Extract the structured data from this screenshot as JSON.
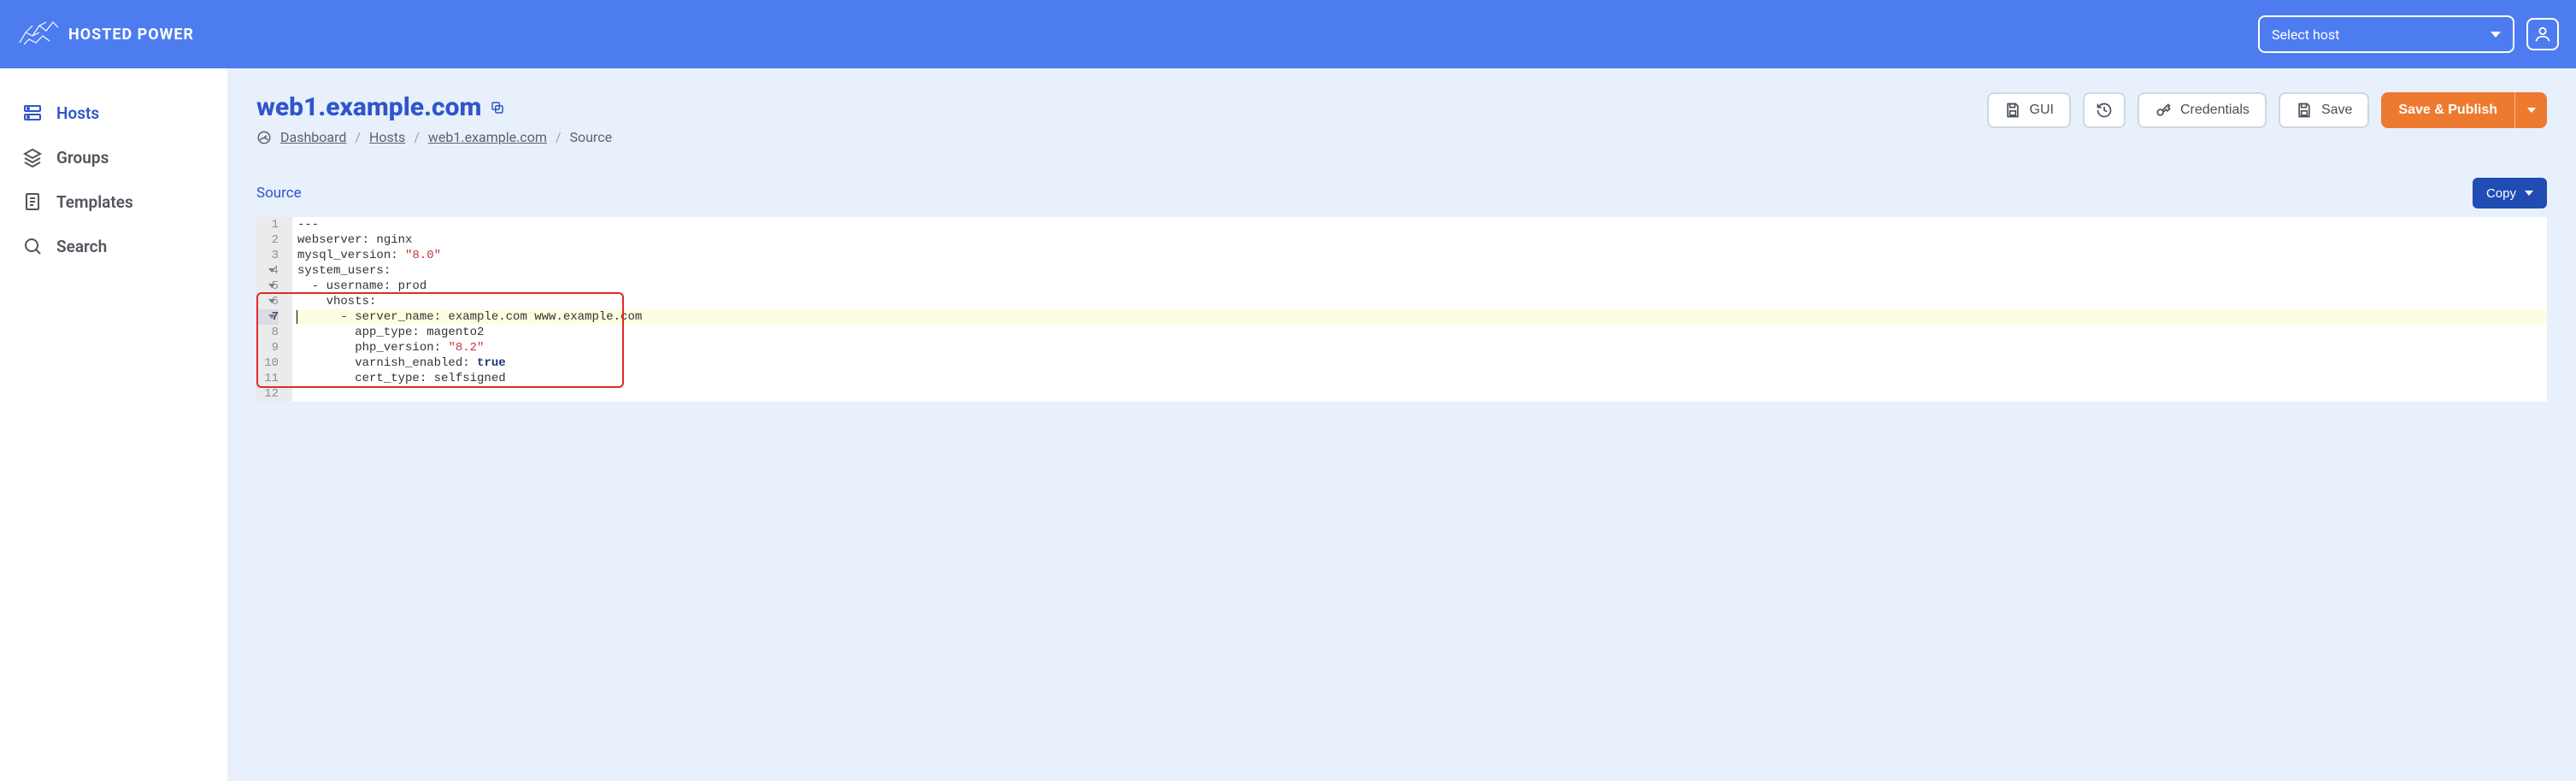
{
  "header": {
    "brand": "HOSTED POWER",
    "host_select_placeholder": "Select host"
  },
  "sidebar": {
    "items": [
      {
        "label": "Hosts",
        "icon": "server-icon",
        "active": true
      },
      {
        "label": "Groups",
        "icon": "layers-icon",
        "active": false
      },
      {
        "label": "Templates",
        "icon": "file-icon",
        "active": false
      },
      {
        "label": "Search",
        "icon": "search-icon",
        "active": false
      }
    ]
  },
  "page": {
    "title": "web1.example.com"
  },
  "breadcrumb": {
    "dashboard": "Dashboard",
    "hosts": "Hosts",
    "host": "web1.example.com",
    "current": "Source"
  },
  "actions": {
    "gui": "GUI",
    "credentials": "Credentials",
    "save": "Save",
    "save_publish": "Save & Publish"
  },
  "section": {
    "title": "Source",
    "copy": "Copy"
  },
  "editor": {
    "active_line": 7,
    "highlight_start": 6,
    "highlight_end": 11,
    "lines": [
      {
        "n": 1,
        "fold": false,
        "tokens": [
          {
            "t": "---"
          }
        ]
      },
      {
        "n": 2,
        "fold": false,
        "tokens": [
          {
            "t": "webserver: nginx"
          }
        ]
      },
      {
        "n": 3,
        "fold": false,
        "tokens": [
          {
            "t": "mysql_version: "
          },
          {
            "t": "\"8.0\"",
            "cls": "tok-str"
          }
        ]
      },
      {
        "n": 4,
        "fold": true,
        "tokens": [
          {
            "t": "system_users:"
          }
        ]
      },
      {
        "n": 5,
        "fold": true,
        "tokens": [
          {
            "t": "  - username: prod"
          }
        ]
      },
      {
        "n": 6,
        "fold": true,
        "tokens": [
          {
            "t": "    vhosts:"
          }
        ]
      },
      {
        "n": 7,
        "fold": true,
        "tokens": [
          {
            "t": "      - server_name: example.com www.example.com"
          }
        ]
      },
      {
        "n": 8,
        "fold": false,
        "tokens": [
          {
            "t": "        app_type: magento2"
          }
        ]
      },
      {
        "n": 9,
        "fold": false,
        "tokens": [
          {
            "t": "        php_version: "
          },
          {
            "t": "\"8.2\"",
            "cls": "tok-str"
          }
        ]
      },
      {
        "n": 10,
        "fold": false,
        "tokens": [
          {
            "t": "        varnish_enabled: "
          },
          {
            "t": "true",
            "cls": "tok-bool"
          }
        ]
      },
      {
        "n": 11,
        "fold": false,
        "tokens": [
          {
            "t": "        cert_type: selfsigned"
          }
        ]
      },
      {
        "n": 12,
        "fold": false,
        "tokens": []
      }
    ]
  }
}
